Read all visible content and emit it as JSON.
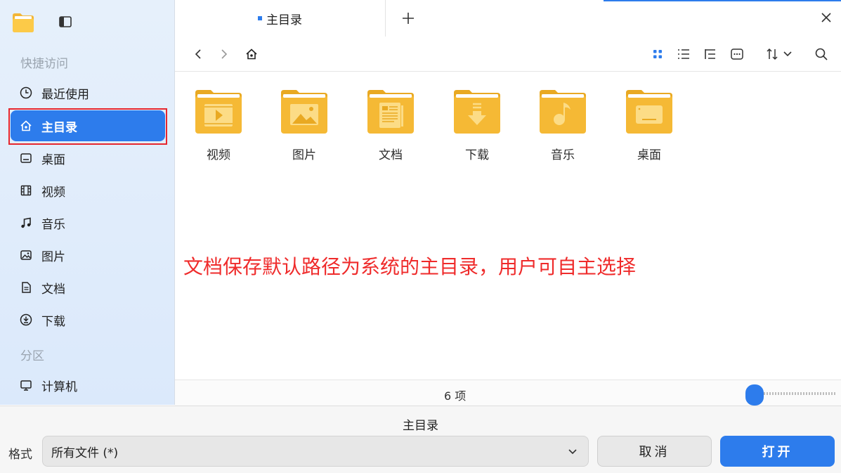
{
  "sidebar": {
    "quick_access_title": "快捷访问",
    "partition_title": "分区",
    "items": [
      {
        "label": "最近使用",
        "icon": "clock-icon"
      },
      {
        "label": "主目录",
        "icon": "home-icon"
      },
      {
        "label": "桌面",
        "icon": "desktop-icon"
      },
      {
        "label": "视频",
        "icon": "film-icon"
      },
      {
        "label": "音乐",
        "icon": "music-note-icon"
      },
      {
        "label": "图片",
        "icon": "image-icon"
      },
      {
        "label": "文档",
        "icon": "document-icon"
      },
      {
        "label": "下载",
        "icon": "download-icon"
      }
    ],
    "partition_items": [
      {
        "label": "计算机",
        "icon": "computer-icon"
      }
    ],
    "active_label": "主目录"
  },
  "tabs": [
    {
      "label": "主目录",
      "active": true
    }
  ],
  "content": {
    "items": [
      {
        "label": "视频",
        "icon": "video-folder-icon"
      },
      {
        "label": "图片",
        "icon": "pictures-folder-icon"
      },
      {
        "label": "文档",
        "icon": "documents-folder-icon"
      },
      {
        "label": "下载",
        "icon": "downloads-folder-icon"
      },
      {
        "label": "音乐",
        "icon": "music-folder-icon"
      },
      {
        "label": "桌面",
        "icon": "desktop-folder-icon"
      }
    ],
    "annotation": "文档保存默认路径为系统的主目录，用户可自主选择"
  },
  "status": {
    "count": "6 项",
    "zoom_level": 0.0
  },
  "footer": {
    "current_dir": "主目录",
    "format_label": "格式",
    "format_value": "所有文件 (*)",
    "cancel_label": "取消",
    "open_label": "打开"
  },
  "colors": {
    "accent": "#2d7cec",
    "folder": "#f2b637",
    "annotation": "#ef2b2b"
  }
}
